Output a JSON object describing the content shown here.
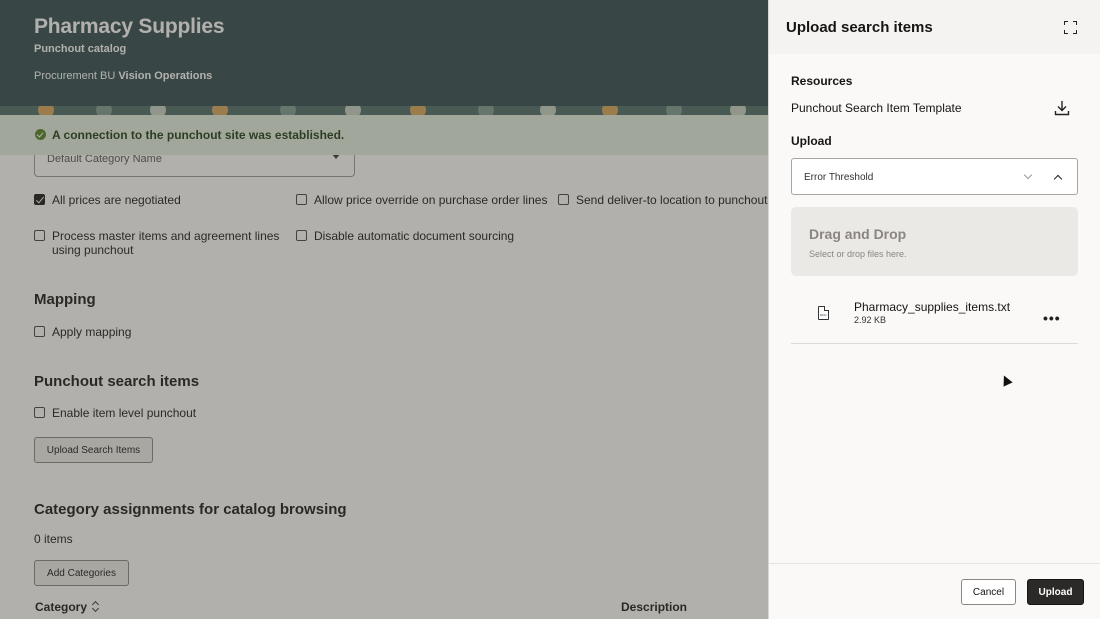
{
  "header": {
    "title": "Pharmacy Supplies",
    "subtitle": "Punchout catalog",
    "bu_label": "Procurement BU",
    "bu_value": "Vision Operations"
  },
  "banner": {
    "message": "A connection to the punchout site was established."
  },
  "category_select": {
    "value": "Default Category Name"
  },
  "options": {
    "all_prices_negotiated": "All prices are negotiated",
    "allow_price_override": "Allow price override on purchase order lines",
    "send_deliver_to": "Send deliver-to location to punchout",
    "process_master_items": "Process master items and agreement lines using punchout",
    "disable_auto_sourcing": "Disable automatic document sourcing"
  },
  "mapping": {
    "title": "Mapping",
    "apply_mapping": "Apply mapping"
  },
  "punchout_search": {
    "title": "Punchout search items",
    "enable_item_level": "Enable item level punchout",
    "upload_button": "Upload Search Items"
  },
  "category_assignments": {
    "title": "Category assignments for catalog browsing",
    "count": "0 items",
    "add_button": "Add Categories",
    "columns": [
      "Category",
      "Description"
    ]
  },
  "drawer": {
    "title": "Upload search items",
    "resources_label": "Resources",
    "template_name": "Punchout Search Item Template",
    "upload_label": "Upload",
    "threshold_value": "Error Threshold",
    "dropzone_title": "Drag and Drop",
    "dropzone_sub": "Select or drop files here.",
    "file": {
      "name": "Pharmacy_supplies_items.txt",
      "size": "2.92 KB"
    },
    "cancel_label": "Cancel",
    "upload_action_label": "Upload"
  },
  "colors": {
    "header_bg": "#2f4a4e",
    "success_bg": "#e3f0df",
    "primary_button": "#2b2a28"
  }
}
